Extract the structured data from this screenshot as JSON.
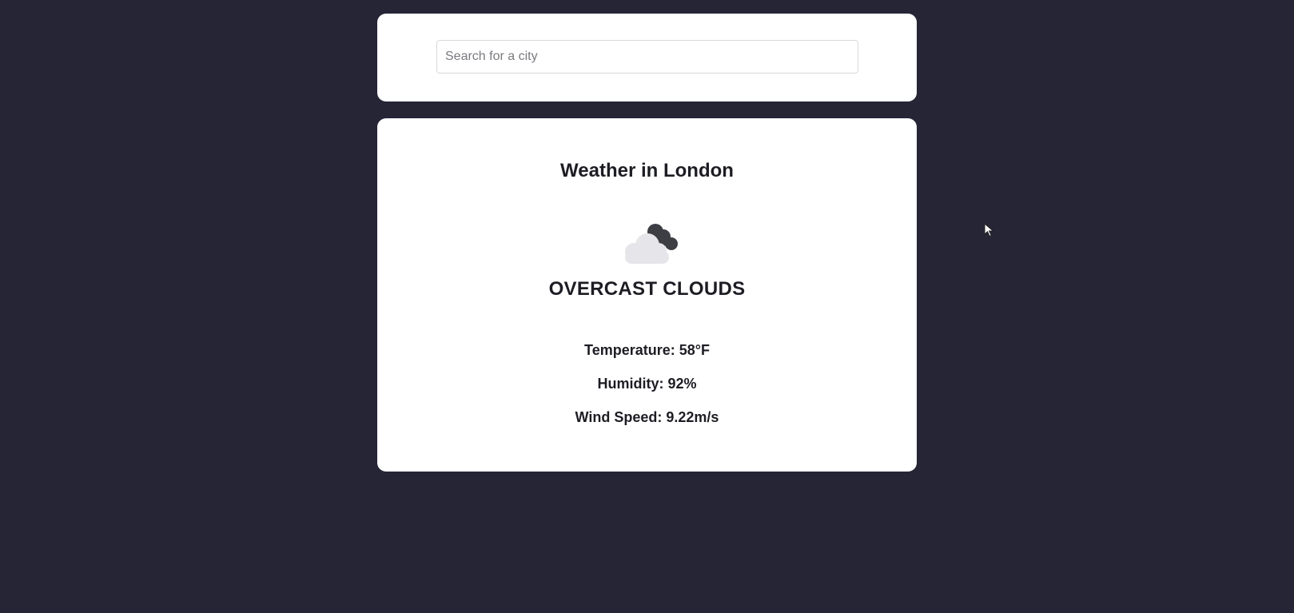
{
  "search": {
    "placeholder": "Search for a city",
    "value": ""
  },
  "weather": {
    "title": "Weather in London",
    "icon": "overcast-clouds-icon",
    "description": "OVERCAST CLOUDS",
    "temperature": "Temperature: 58°F",
    "humidity": "Humidity: 92%",
    "wind_speed": "Wind Speed: 9.22m/s"
  },
  "colors": {
    "background": "#252536",
    "card": "#ffffff",
    "text": "#1d1d24"
  }
}
